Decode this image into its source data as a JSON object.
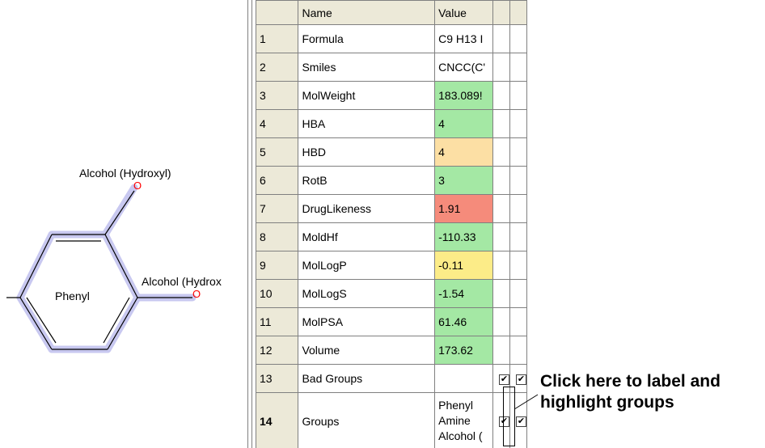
{
  "molecule": {
    "labels": {
      "hydroxyl_top": "Alcohol (Hydroxyl)",
      "hydroxyl_mid": "Alcohol (Hydrox",
      "phenyl": "Phenyl",
      "atom_o": "O"
    },
    "colors": {
      "highlight": "#c8c8f0",
      "bond": "#000000",
      "oxygen": "#ff0000"
    }
  },
  "grid": {
    "headers": {
      "name": "Name",
      "value": "Value"
    },
    "rows": [
      {
        "num": "1",
        "name": "Formula",
        "value": "C9 H13 I",
        "color": "#ffffff"
      },
      {
        "num": "2",
        "name": "Smiles",
        "value": "CNCC(C'",
        "color": "#ffffff"
      },
      {
        "num": "3",
        "name": "MolWeight",
        "value": "183.089!",
        "color": "#a4e8a4"
      },
      {
        "num": "4",
        "name": "HBA",
        "value": "4",
        "color": "#a4e8a4"
      },
      {
        "num": "5",
        "name": "HBD",
        "value": "4",
        "color": "#fcdfa4"
      },
      {
        "num": "6",
        "name": "RotB",
        "value": "3",
        "color": "#a4e8a4"
      },
      {
        "num": "7",
        "name": "DrugLikeness",
        "value": "1.91",
        "color": "#f58b7b"
      },
      {
        "num": "8",
        "name": "MoldHf",
        "value": "-110.33",
        "color": "#a4e8a4"
      },
      {
        "num": "9",
        "name": "MolLogP",
        "value": "-0.11",
        "color": "#fcec88"
      },
      {
        "num": "10",
        "name": "MolLogS",
        "value": "-1.54",
        "color": "#a4e8a4"
      },
      {
        "num": "11",
        "name": "MolPSA",
        "value": "61.46",
        "color": "#a4e8a4"
      },
      {
        "num": "12",
        "name": "Volume",
        "value": "173.62",
        "color": "#a4e8a4"
      }
    ],
    "bad_groups": {
      "num": "13",
      "name": "Bad Groups",
      "checks": [
        "✔",
        "✔"
      ]
    },
    "groups": {
      "num": "14",
      "name": "Groups",
      "lines": [
        "Phenyl",
        "Amine",
        "Alcohol ("
      ],
      "checks": [
        "✔",
        "✔"
      ]
    }
  },
  "annotation": {
    "line1": "Click here to label and",
    "line2": "highlight groups"
  }
}
